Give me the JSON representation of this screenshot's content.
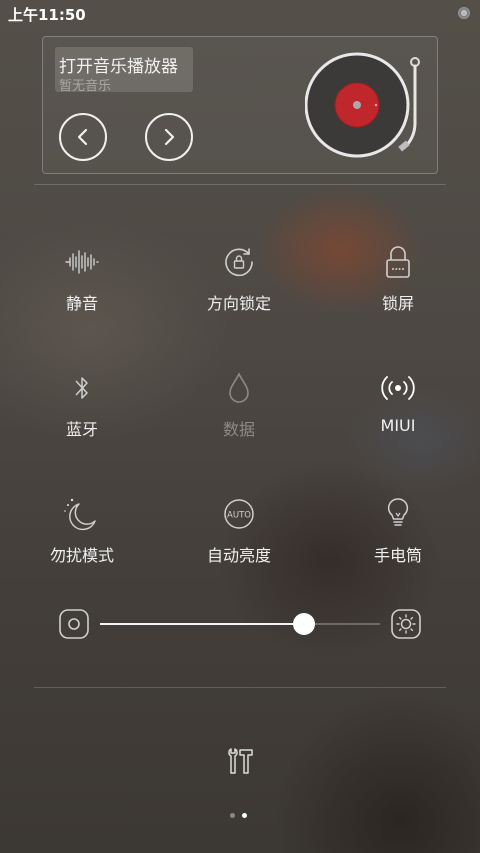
{
  "status_bar": {
    "time": "上午11:50"
  },
  "music": {
    "title": "打开音乐播放器",
    "subtitle": "暂无音乐",
    "prev_icon": "chevron-left-icon",
    "next_icon": "chevron-right-icon",
    "record_icon": "vinyl-record-icon"
  },
  "toggles": [
    {
      "label": "静音",
      "icon": "mute-waveform-icon",
      "active": true
    },
    {
      "label": "方向锁定",
      "icon": "rotation-lock-icon",
      "active": true
    },
    {
      "label": "锁屏",
      "icon": "lock-icon",
      "active": true
    },
    {
      "label": "蓝牙",
      "icon": "bluetooth-icon",
      "active": true
    },
    {
      "label": "数据",
      "icon": "data-drop-icon",
      "active": false
    },
    {
      "label": "MIUI",
      "icon": "hotspot-icon",
      "active": true
    },
    {
      "label": "勿扰模式",
      "icon": "moon-icon",
      "active": true
    },
    {
      "label": "自动亮度",
      "icon": "auto-brightness-icon",
      "active": true
    },
    {
      "label": "手电筒",
      "icon": "flashlight-icon",
      "active": true
    }
  ],
  "brightness": {
    "level": 0.73,
    "low_icon": "brightness-low-icon",
    "high_icon": "brightness-high-icon"
  },
  "footer": {
    "tools_icon": "tools-icon",
    "page_count": 2,
    "current_page": 2
  }
}
